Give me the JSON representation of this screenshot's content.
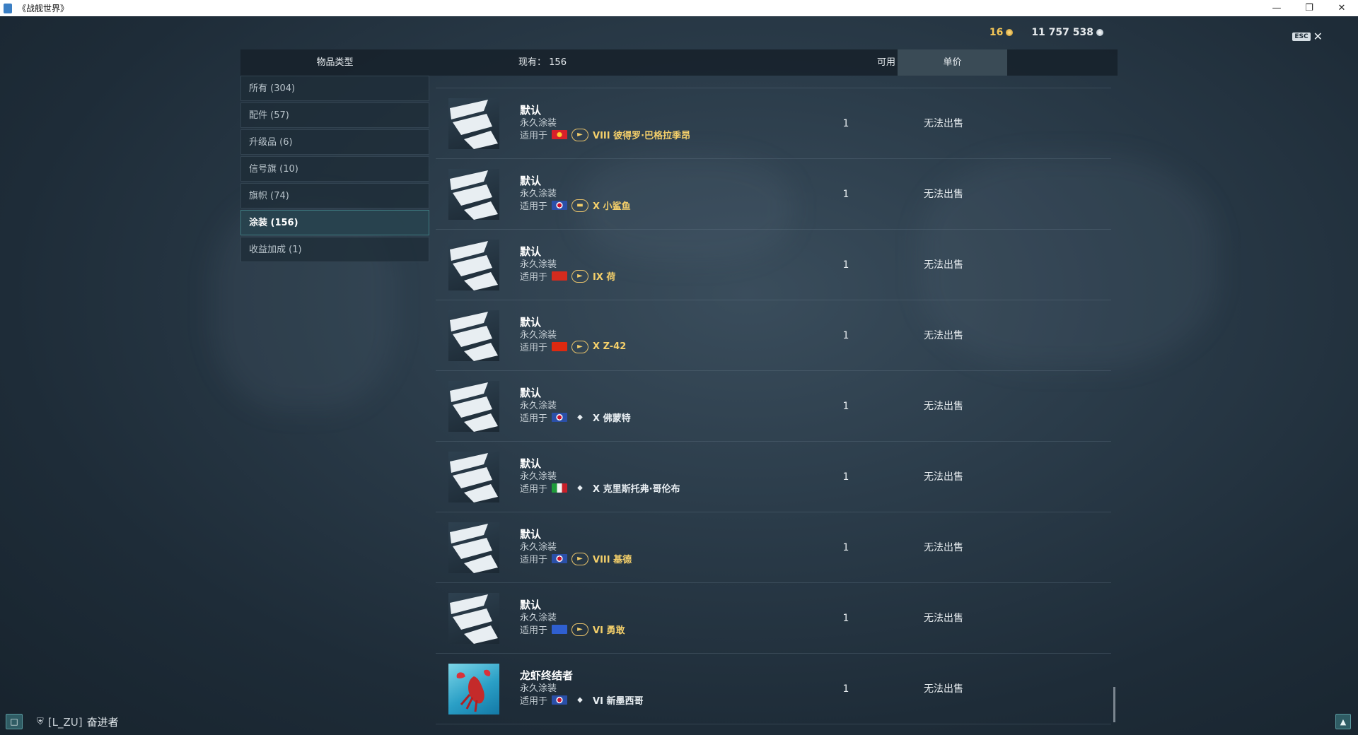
{
  "window": {
    "title": "《战舰世界》",
    "controls": [
      "minimize",
      "restore",
      "close"
    ]
  },
  "currency": {
    "gold": "16",
    "silver": "11 757 538"
  },
  "esc_label": "ESC",
  "header": {
    "item_type": "物品类型",
    "count_label": "现有：",
    "count_value": "156",
    "available": "可用",
    "unit_price": "单价"
  },
  "sidebar": {
    "items": [
      {
        "label": "所有 (304)"
      },
      {
        "label": "配件 (57)"
      },
      {
        "label": "升级品 (6)"
      },
      {
        "label": "信号旗 (10)"
      },
      {
        "label": "旗帜 (74)"
      },
      {
        "label": "涂装 (156)",
        "active": true
      },
      {
        "label": "收益加成 (1)"
      }
    ]
  },
  "rows": [
    {
      "name": "默认",
      "type": "永久涂装",
      "for_label": "适用于",
      "nation": "pan-asia",
      "tier_class": "destroyer-elite",
      "ship": "VIII 彼得罗·巴格拉季昂",
      "available": "1",
      "price": "无法出售"
    },
    {
      "name": "默认",
      "type": "永久涂装",
      "for_label": "适用于",
      "nation": "uk",
      "tier_class": "submarine-elite",
      "ship": "X 小鲨鱼",
      "available": "1",
      "price": "无法出售"
    },
    {
      "name": "默认",
      "type": "永久涂装",
      "for_label": "适用于",
      "nation": "switzerland",
      "tier_class": "destroyer-elite",
      "ship": "IX 荷",
      "available": "1",
      "price": "无法出售"
    },
    {
      "name": "默认",
      "type": "永久涂装",
      "for_label": "适用于",
      "nation": "china",
      "tier_class": "destroyer-elite",
      "ship": "X Z-42",
      "available": "1",
      "price": "无法出售"
    },
    {
      "name": "默认",
      "type": "永久涂装",
      "for_label": "适用于",
      "nation": "uk",
      "tier_class": "cruiser",
      "ship": "X 佛蒙特",
      "available": "1",
      "price": "无法出售"
    },
    {
      "name": "默认",
      "type": "永久涂装",
      "for_label": "适用于",
      "nation": "italy",
      "tier_class": "cruiser",
      "ship": "X 克里斯托弗·哥伦布",
      "available": "1",
      "price": "无法出售"
    },
    {
      "name": "默认",
      "type": "永久涂装",
      "for_label": "适用于",
      "nation": "uk",
      "tier_class": "destroyer-elite",
      "ship": "VIII 基德",
      "available": "1",
      "price": "无法出售"
    },
    {
      "name": "默认",
      "type": "永久涂装",
      "for_label": "适用于",
      "nation": "europe",
      "tier_class": "destroyer-elite",
      "ship": "VI 勇敢",
      "available": "1",
      "price": "无法出售"
    },
    {
      "name": "龙虾终结者",
      "type": "永久涂装",
      "for_label": "适用于",
      "nation": "uk",
      "tier_class": "cruiser",
      "ship": "VI 新墨西哥",
      "available": "1",
      "price": "无法出售"
    }
  ],
  "bottom": {
    "clan": "[L_ZU]",
    "player": "奋进者"
  },
  "colors": {
    "accent_gold": "#f4cf6a",
    "active_border": "#50aaaa"
  }
}
